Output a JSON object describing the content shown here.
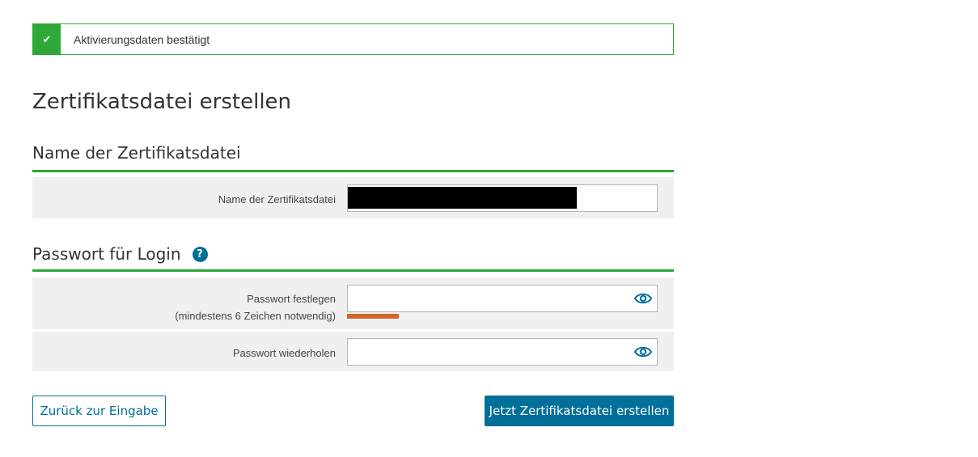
{
  "alert": {
    "icon": "checkmark-icon",
    "message": "Aktivierungsdaten bestätigt",
    "color": "#2ea836"
  },
  "page": {
    "title": "Zertifikatsdatei erstellen"
  },
  "sections": {
    "filename": {
      "title": "Name der Zertifikatsdatei",
      "field_label": "Name der Zertifikatsdatei",
      "field_value_redacted": true
    },
    "password": {
      "title": "Passwort für Login",
      "help_icon": "question-icon",
      "set_label": "Passwort festlegen",
      "set_hint": "(mindestens 6 Zeichen notwendig)",
      "repeat_label": "Passwort wiederholen",
      "eye_icon": "eye-icon",
      "strength_color": "#d4652a"
    }
  },
  "buttons": {
    "back": "Zurück zur Eingabe",
    "create": "Jetzt Zertifikatsdatei erstellen"
  },
  "colors": {
    "accent_green": "#2ea836",
    "primary_blue": "#006f99",
    "row_bg": "#f0f0f0"
  }
}
